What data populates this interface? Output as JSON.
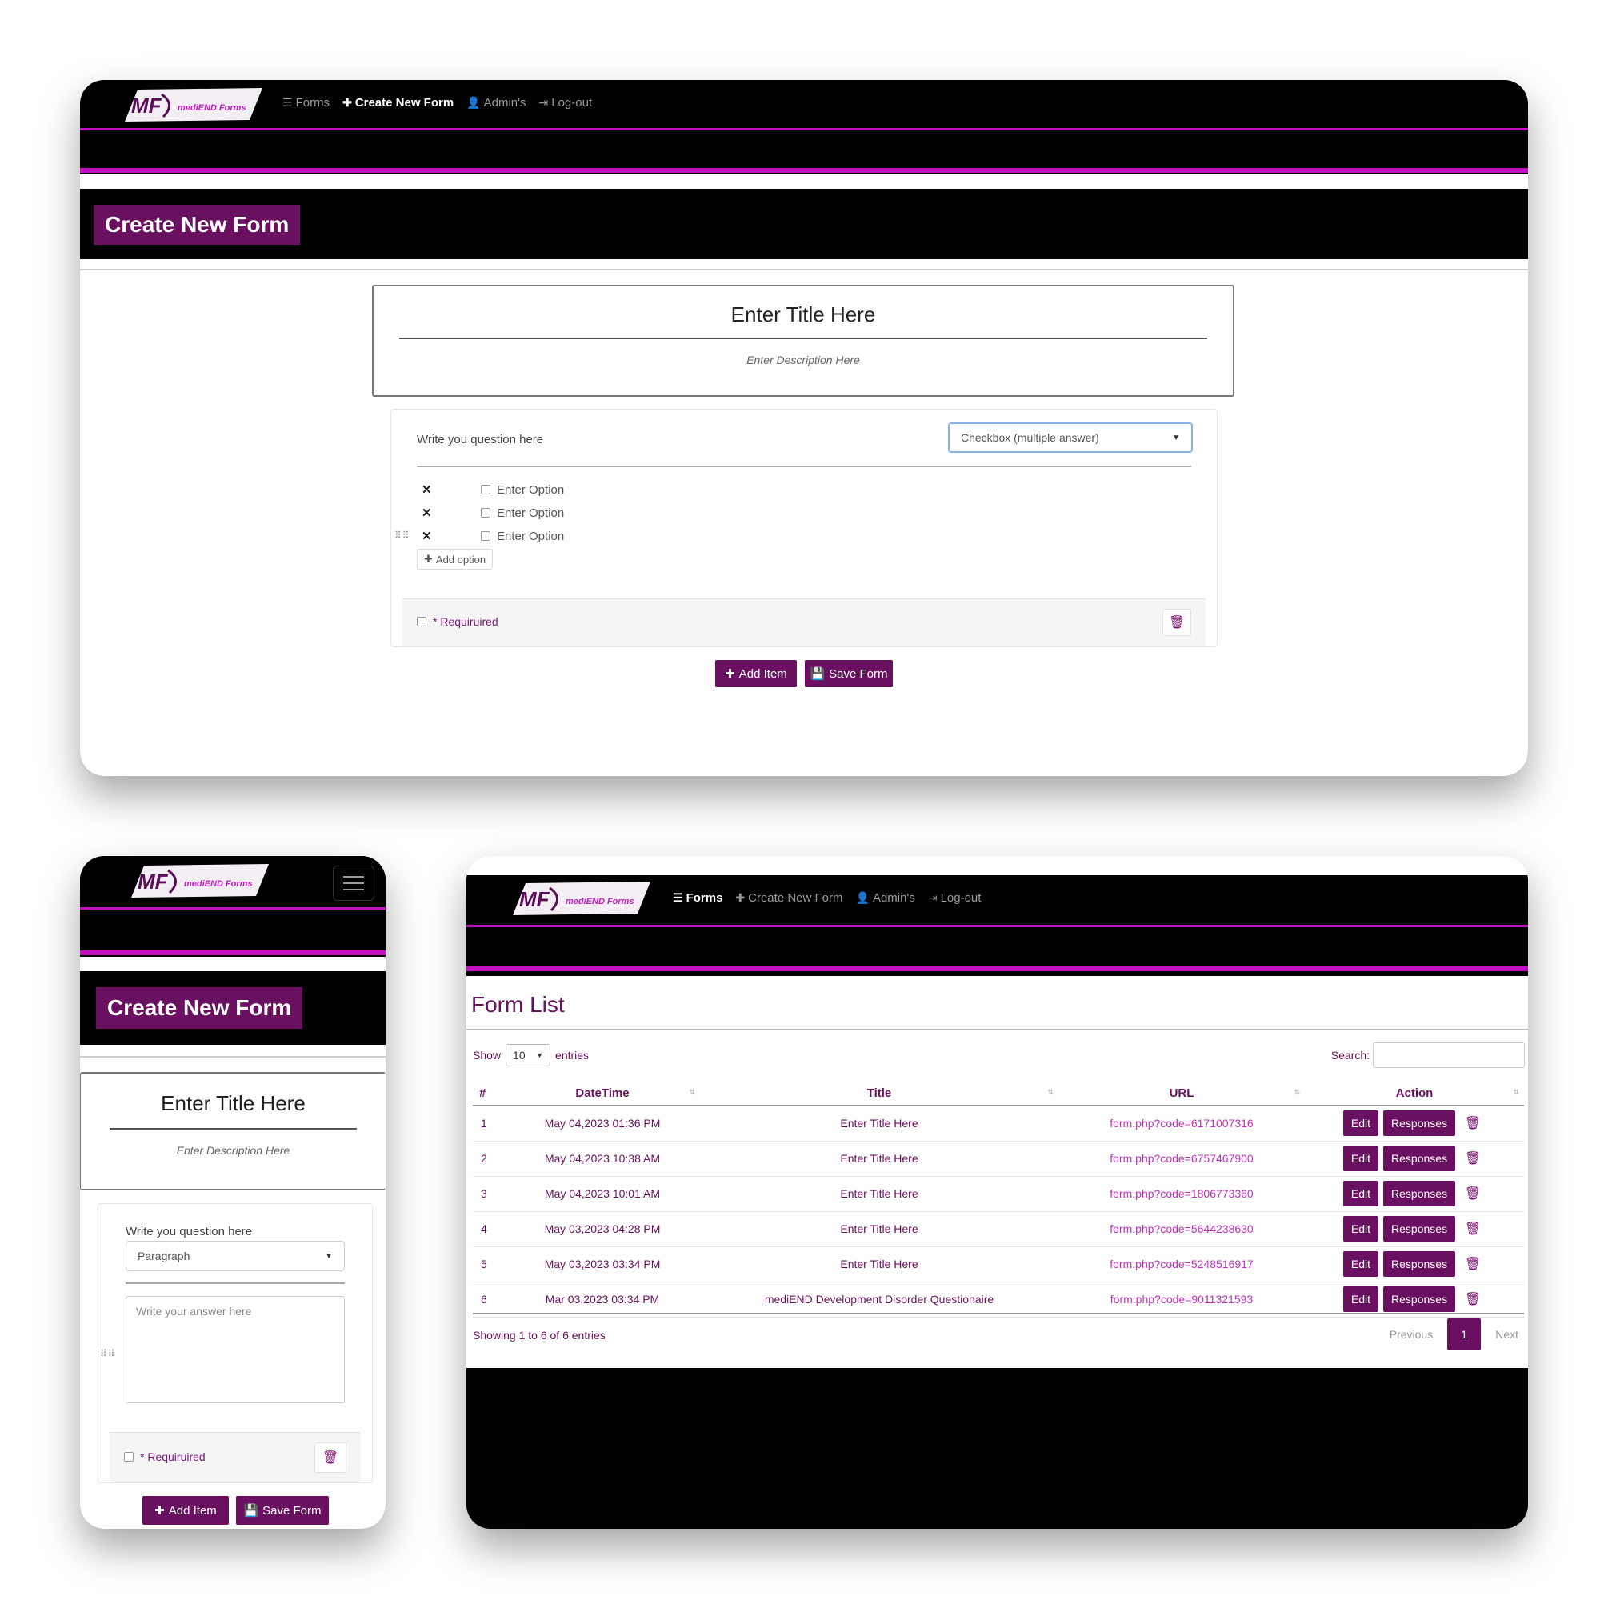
{
  "brand": {
    "logo_text": "mediEND Forms",
    "logo_mark": "MF"
  },
  "nav": {
    "forms": "Forms",
    "create": "Create New Form",
    "admins": "Admin's",
    "logout": "Log-out"
  },
  "create_form": {
    "heading": "Create New Form",
    "title_placeholder": "Enter Title Here",
    "description_placeholder": "Enter Description Here",
    "question_placeholder": "Write you question here",
    "required_label": "* Requiruired",
    "add_item": "Add Item",
    "save_form": "Save Form"
  },
  "desktop_question": {
    "type": "Checkbox (multiple answer)",
    "options": [
      "Enter Option",
      "Enter Option",
      "Enter Option"
    ],
    "add_option": "Add option"
  },
  "mobile_question": {
    "type": "Paragraph",
    "answer_placeholder": "Write your answer here"
  },
  "form_list": {
    "heading": "Form List",
    "show_label": "Show",
    "entries_value": "10",
    "entries_label": "entries",
    "search_label": "Search:",
    "columns": [
      "#",
      "DateTime",
      "Title",
      "URL",
      "Action"
    ],
    "rows": [
      {
        "num": "1",
        "datetime": "May 04,2023 01:36 PM",
        "title": "Enter Title Here",
        "url": "form.php?code=6171007316"
      },
      {
        "num": "2",
        "datetime": "May 04,2023 10:38 AM",
        "title": "Enter Title Here",
        "url": "form.php?code=6757467900"
      },
      {
        "num": "3",
        "datetime": "May 04,2023 10:01 AM",
        "title": "Enter Title Here",
        "url": "form.php?code=1806773360"
      },
      {
        "num": "4",
        "datetime": "May 03,2023 04:28 PM",
        "title": "Enter Title Here",
        "url": "form.php?code=5644238630"
      },
      {
        "num": "5",
        "datetime": "May 03,2023 03:34 PM",
        "title": "Enter Title Here",
        "url": "form.php?code=5248516917"
      },
      {
        "num": "6",
        "datetime": "Mar 03,2023 03:34 PM",
        "title": "mediEND Development Disorder Questionaire",
        "url": "form.php?code=9011321593"
      }
    ],
    "edit_label": "Edit",
    "responses_label": "Responses",
    "showing": "Showing 1 to 6 of 6 entries",
    "previous": "Previous",
    "current_page": "1",
    "next": "Next"
  },
  "colors": {
    "accent": "#6a1060",
    "nav_line": "#c010c0",
    "link": "#c030c0"
  },
  "icons": [
    "list-icon",
    "plus-icon",
    "user-icon",
    "logout-icon",
    "close-icon",
    "drag-handle-icon",
    "trash-icon",
    "save-icon",
    "hamburger-icon",
    "chevron-down-icon"
  ]
}
